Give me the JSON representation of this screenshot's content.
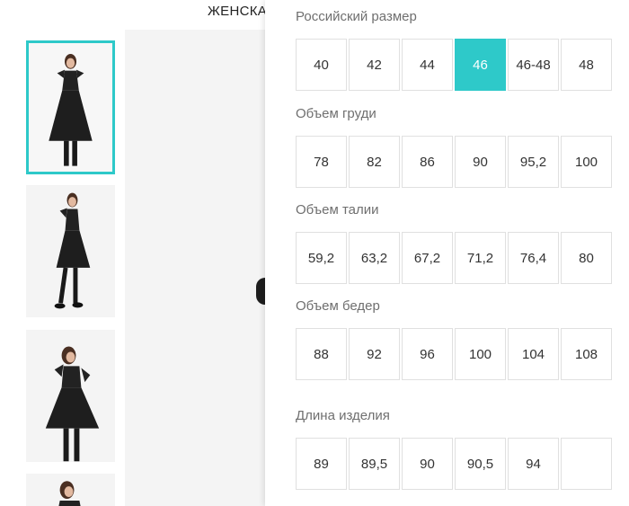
{
  "header": {
    "title": "ЖЕНСКА"
  },
  "gallery": {
    "thumbnails": [
      {
        "alt": "dress-front",
        "active": true
      },
      {
        "alt": "dress-side",
        "active": false
      },
      {
        "alt": "dress-pose",
        "active": false
      },
      {
        "alt": "dress-partial",
        "active": false
      }
    ],
    "accent_color": "#2ec9c9"
  },
  "size_table": {
    "russian_size": {
      "label": "Российский размер",
      "values": [
        "40",
        "42",
        "44",
        "46",
        "46-48",
        "48"
      ],
      "selected_index": 3
    },
    "bust": {
      "label": "Объем груди",
      "values": [
        "78",
        "82",
        "86",
        "90",
        "95,2",
        "100"
      ]
    },
    "waist": {
      "label": "Объем талии",
      "values": [
        "59,2",
        "63,2",
        "67,2",
        "71,2",
        "76,4",
        "80"
      ]
    },
    "hips": {
      "label": "Объем бедер",
      "values": [
        "88",
        "92",
        "96",
        "100",
        "104",
        "108"
      ]
    },
    "length": {
      "label": "Длина изделия",
      "values": [
        "89",
        "89,5",
        "90",
        "90,5",
        "94",
        ""
      ]
    }
  }
}
